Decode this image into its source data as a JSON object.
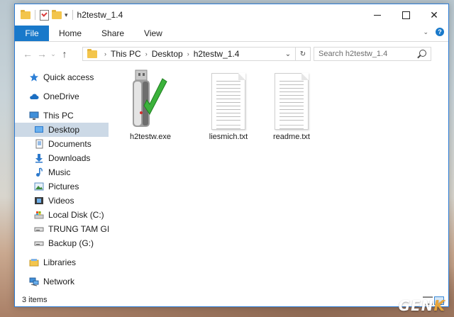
{
  "window": {
    "title": "h2testw_1.4"
  },
  "ribbon": {
    "tabs": [
      {
        "label": "File",
        "active": true
      },
      {
        "label": "Home"
      },
      {
        "label": "Share"
      },
      {
        "label": "View"
      }
    ]
  },
  "address": {
    "crumbs": [
      "This PC",
      "Desktop",
      "h2testw_1.4"
    ]
  },
  "search": {
    "placeholder": "Search h2testw_1.4"
  },
  "sidebar": {
    "items": [
      {
        "label": "Quick access",
        "icon": "star-icon"
      },
      {
        "label": "OneDrive",
        "icon": "cloud-icon"
      },
      {
        "label": "This PC",
        "icon": "computer-icon"
      },
      {
        "label": "Desktop",
        "icon": "desktop-icon",
        "selected": true
      },
      {
        "label": "Documents",
        "icon": "documents-icon"
      },
      {
        "label": "Downloads",
        "icon": "download-icon"
      },
      {
        "label": "Music",
        "icon": "music-icon"
      },
      {
        "label": "Pictures",
        "icon": "pictures-icon"
      },
      {
        "label": "Videos",
        "icon": "videos-icon"
      },
      {
        "label": "Local Disk (C:)",
        "icon": "local-disk-icon"
      },
      {
        "label": "TRUNG TAM GIAI T",
        "icon": "drive-icon"
      },
      {
        "label": "Backup (G:)",
        "icon": "drive-icon"
      },
      {
        "label": "Libraries",
        "icon": "libraries-icon"
      },
      {
        "label": "Network",
        "icon": "network-icon"
      }
    ]
  },
  "files": [
    {
      "name": "h2testw.exe",
      "icon": "usb-drive-check-icon"
    },
    {
      "name": "liesmich.txt",
      "icon": "text-file-icon"
    },
    {
      "name": "readme.txt",
      "icon": "text-file-icon"
    }
  ],
  "status": {
    "count": "3 items"
  },
  "watermark": {
    "brand": "GENK"
  },
  "colors": {
    "accent": "#1979ca",
    "selection": "#ccd9e6",
    "check_green": "#3bb23b"
  }
}
